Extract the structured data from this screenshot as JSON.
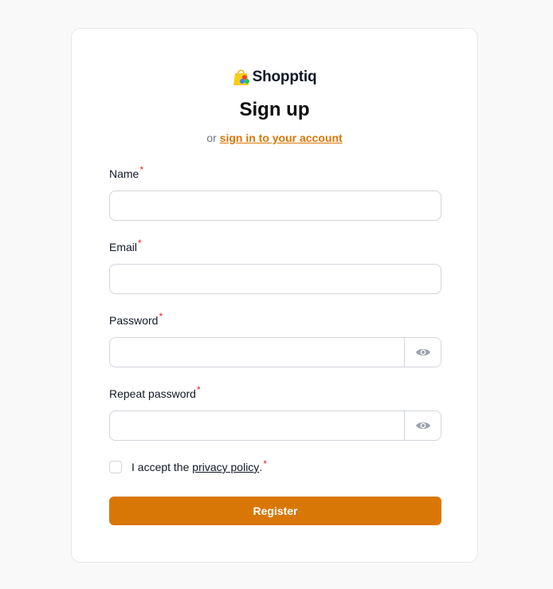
{
  "brand": {
    "name": "Shopptiq",
    "colors": {
      "bag": "#facc15",
      "dot_red": "#ef4444",
      "dot_blue": "#3b82f6",
      "dot_green": "#22c55e"
    }
  },
  "title": "Sign up",
  "subtitle": {
    "prefix": "or",
    "link": "sign in to your account"
  },
  "fields": {
    "name": {
      "label": "Name",
      "required": "*",
      "value": ""
    },
    "email": {
      "label": "Email",
      "required": "*",
      "value": ""
    },
    "password": {
      "label": "Password",
      "required": "*",
      "value": "",
      "toggle_icon": "eye-icon"
    },
    "repeat_password": {
      "label": "Repeat password",
      "required": "*",
      "value": "",
      "toggle_icon": "eye-icon"
    }
  },
  "consent": {
    "prefix": "I accept the",
    "link": "privacy policy",
    "suffix": ".",
    "required": "*",
    "checked": false
  },
  "register_label": "Register",
  "colors": {
    "accent": "#d97706",
    "required": "#dc2626",
    "border": "#d1d5db",
    "background": "#f9f9f9"
  }
}
